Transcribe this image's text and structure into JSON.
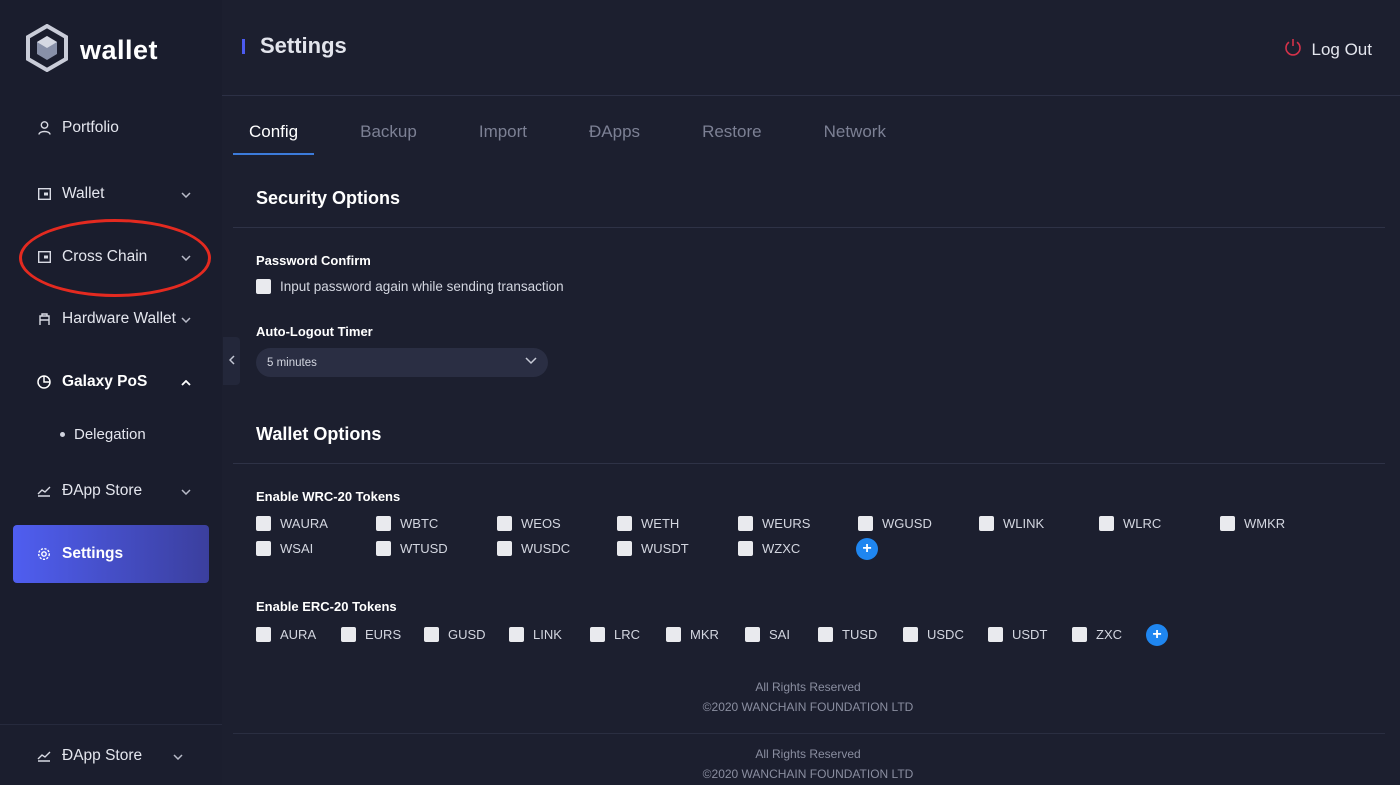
{
  "app": {
    "logo_text": "wallet"
  },
  "sidebar": {
    "items": [
      {
        "label": "Portfolio"
      },
      {
        "label": "Wallet"
      },
      {
        "label": "Cross Chain"
      },
      {
        "label": "Hardware Wallet"
      },
      {
        "label": "Galaxy PoS"
      },
      {
        "label": "ĐApp Store"
      },
      {
        "label": "Settings"
      }
    ],
    "sub_items": [
      {
        "label": "Delegation"
      }
    ],
    "footer_item": {
      "label": "ĐApp Store"
    }
  },
  "header": {
    "title": "Settings",
    "logout_label": "Log Out"
  },
  "tabs": [
    {
      "label": "Config"
    },
    {
      "label": "Backup"
    },
    {
      "label": "Import"
    },
    {
      "label": "ĐApps"
    },
    {
      "label": "Restore"
    },
    {
      "label": "Network"
    }
  ],
  "security": {
    "title": "Security Options",
    "password_confirm_label": "Password Confirm",
    "password_confirm_checkbox": "Input password again while sending transaction",
    "auto_logout_label": "Auto-Logout Timer",
    "auto_logout_value": "5 minutes"
  },
  "wallet_options": {
    "title": "Wallet Options",
    "wrc20_label": "Enable WRC-20 Tokens",
    "wrc20_tokens": [
      "WAURA",
      "WBTC",
      "WEOS",
      "WETH",
      "WEURS",
      "WGUSD",
      "WLINK",
      "WLRC",
      "WMKR",
      "WSAI",
      "WTUSD",
      "WUSDC",
      "WUSDT",
      "WZXC"
    ],
    "erc20_label": "Enable ERC-20 Tokens",
    "erc20_tokens": [
      "AURA",
      "EURS",
      "GUSD",
      "LINK",
      "LRC",
      "MKR",
      "SAI",
      "TUSD",
      "USDC",
      "USDT",
      "ZXC"
    ],
    "add_symbol": "+"
  },
  "footer": {
    "rights": "All Rights Reserved",
    "copyright": "©2020 WANCHAIN FOUNDATION LTD"
  },
  "colors": {
    "accent": "#4f5ef0",
    "annotation_circle": "#e42a20",
    "add_button": "#1f86f0",
    "logout_icon": "#d4324a"
  }
}
